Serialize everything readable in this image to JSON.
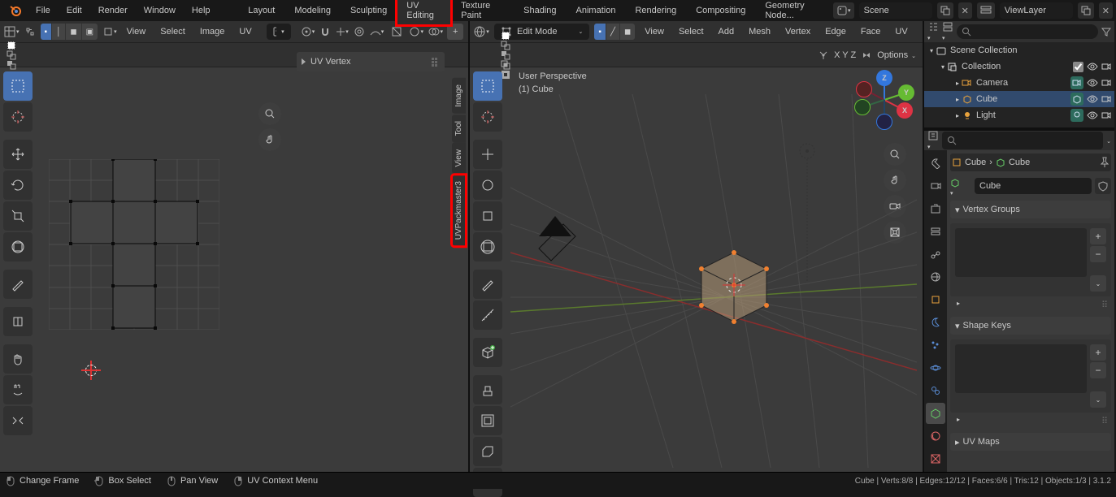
{
  "top_menu": {
    "file": "File",
    "edit": "Edit",
    "render": "Render",
    "window": "Window",
    "help": "Help"
  },
  "workspaces": {
    "layout": "Layout",
    "modeling": "Modeling",
    "sculpting": "Sculpting",
    "uv_editing": "UV Editing",
    "texture_paint": "Texture Paint",
    "shading": "Shading",
    "animation": "Animation",
    "rendering": "Rendering",
    "compositing": "Compositing",
    "geometry_nodes": "Geometry Node..."
  },
  "scene_field": "Scene",
  "viewlayer_field": "ViewLayer",
  "uv_header": {
    "view": "View",
    "select": "Select",
    "image": "Image",
    "uv": "UV"
  },
  "uv_npanel": {
    "header": "UV Vertex",
    "tabs": {
      "image": "Image",
      "tool": "Tool",
      "view": "View",
      "uvpm": "UVPackmaster3"
    }
  },
  "viewport_header": {
    "mode": "Edit Mode",
    "view": "View",
    "select": "Select",
    "add": "Add",
    "mesh": "Mesh",
    "vertex": "Vertex",
    "edge": "Edge",
    "face": "Face",
    "uv": "UV"
  },
  "viewport_sub": {
    "axes": {
      "x": "X",
      "y": "Y",
      "z": "Z"
    },
    "options": "Options"
  },
  "viewport_overlay": {
    "line1": "User Perspective",
    "line2": "(1) Cube"
  },
  "outliner": {
    "scene_collection": "Scene Collection",
    "collection": "Collection",
    "camera": "Camera",
    "cube": "Cube",
    "light": "Light"
  },
  "properties": {
    "breadcrumb_1": "Cube",
    "breadcrumb_2": "Cube",
    "name_field": "Cube",
    "vertex_groups": "Vertex Groups",
    "shape_keys": "Shape Keys",
    "uv_maps": "UV Maps"
  },
  "statusbar": {
    "h1": "Change Frame",
    "h2": "Box Select",
    "h3": "Pan View",
    "h4": "UV Context Menu",
    "right": "Cube | Verts:8/8 | Edges:12/12 | Faces:6/6 | Tris:12 | Objects:1/3 | 3.1.2"
  }
}
